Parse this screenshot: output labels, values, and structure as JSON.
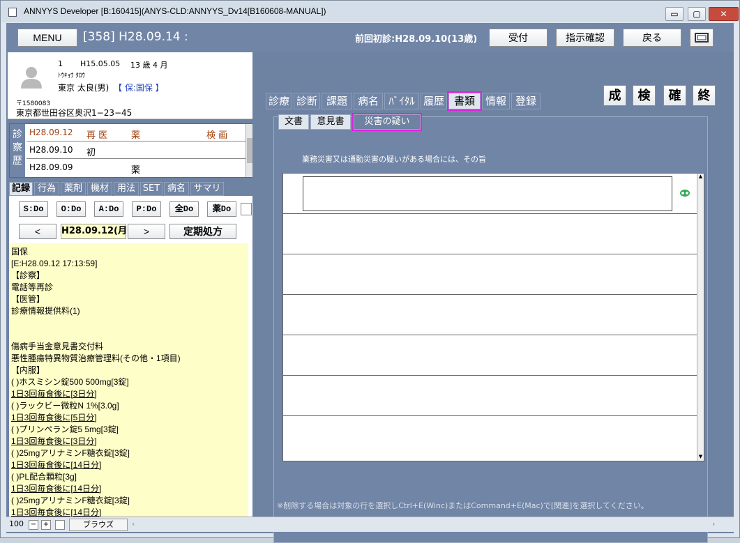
{
  "window": {
    "title": "ANNYYS Developer [B:160415](ANYS-CLD:ANNYYS_Dv14[B160608-MANUAL])",
    "minimize_icon": "▭",
    "maximize_icon": "▢",
    "close_icon": "✕"
  },
  "topbar": {
    "menu_label": "MENU",
    "record_id": "[358] H28.09.14 :",
    "prev_visit": "前回初診:H28.09.10(13歳)",
    "buttons": [
      "受付",
      "指示確認",
      "戻る"
    ]
  },
  "patient": {
    "no": "1",
    "birth": "H15.05.05",
    "age": "13 歳 4 月",
    "kana": "ﾄｳｷｮｳ ﾀﾛｳ",
    "name": "東京 太良(男)",
    "insurance": "【 保:国保 】",
    "postal": "〒1580083",
    "address": "東京都世田谷区奥沢1−23−45"
  },
  "history": {
    "label": "診察歴",
    "rows": [
      {
        "date": "H28.09.12",
        "type": "再 医",
        "med": "薬",
        "flags": "検 画"
      },
      {
        "date": "H28.09.10",
        "type": "初",
        "med": "",
        "flags": ""
      },
      {
        "date": "H28.09.09",
        "type": "",
        "med": "薬",
        "flags": ""
      }
    ]
  },
  "left_tabs": [
    "記録",
    "行為",
    "薬剤",
    "機材",
    "用法",
    "SET",
    "病名",
    "サマリ"
  ],
  "do_buttons": [
    "S:Do",
    "O:Do",
    "A:Do",
    "P:Do",
    "全Do",
    "薬Do"
  ],
  "date_nav": {
    "prev": "<",
    "date": "H28.09.12(月)",
    "next": ">",
    "teiki": "定期処方"
  },
  "note_lines": [
    {
      "t": "国保",
      "u": false
    },
    {
      "t": "[E:H28.09.12  17:13:59]",
      "u": false
    },
    {
      "t": "【診察】",
      "u": false
    },
    {
      "t": "電話等再診",
      "u": false
    },
    {
      "t": "【医管】",
      "u": false
    },
    {
      "t": "診療情報提供料(1)",
      "u": false
    },
    {
      "t": "",
      "u": false
    },
    {
      "t": "",
      "u": false
    },
    {
      "t": "傷病手当金意見書交付料",
      "u": false
    },
    {
      "t": "悪性腫瘍特異物質治療管理料(その他・1項目)",
      "u": false
    },
    {
      "t": "【内服】",
      "u": false
    },
    {
      "t": "( )ホスミシン錠500  500mg[3錠]",
      "u": false
    },
    {
      "t": "1日3回毎食後に[3日分]",
      "u": true
    },
    {
      "t": "( )ラックビー微粒N  1%[3.0g]",
      "u": false
    },
    {
      "t": "1日3回毎食後に[5日分]",
      "u": true
    },
    {
      "t": "( )プリンペラン錠5  5mg[3錠]",
      "u": false
    },
    {
      "t": "1日3回毎食後に[3日分]",
      "u": true
    },
    {
      "t": "( )25mgアリナミンF糖衣錠[3錠]",
      "u": false
    },
    {
      "t": "1日3回毎食後に[14日分]",
      "u": true
    },
    {
      "t": "( )PL配合顆粒[3g]",
      "u": false
    },
    {
      "t": "1日3回毎食後に[14日分]",
      "u": true
    },
    {
      "t": "( )25mgアリナミンF糖衣錠[3錠]",
      "u": false
    },
    {
      "t": "1日3回毎食後に[14日分]",
      "u": true
    }
  ],
  "top_tabs": [
    "診療",
    "診断",
    "課題",
    "病名",
    "ﾊﾞｲﾀﾙ",
    "履歴",
    "書類",
    "情報",
    "登録"
  ],
  "side_buttons": [
    "成",
    "検",
    "確",
    "終"
  ],
  "sub_tabs": [
    "文書",
    "意見書",
    "災害の疑い"
  ],
  "disaster_label": "業務災害又は通勤災害の疑いがある場合には、その旨",
  "footer_hint": "※削除する場合は対象の行を選択しCtrl+E(Winc)またはCommand+E(Mac)で[関連]を選択してください。",
  "status": {
    "zoom": "100",
    "mode": "ブラウズ"
  }
}
